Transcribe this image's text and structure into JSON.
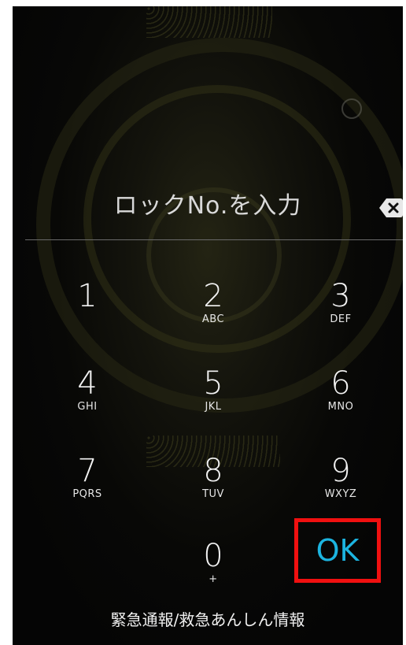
{
  "lock_screen": {
    "prompt": "ロックNo.を入力",
    "backspace_icon": "backspace-icon",
    "accent_color": "#1cb4e0",
    "highlight_color": "#f01010"
  },
  "keypad": {
    "keys": [
      {
        "digit": "1",
        "letters": ""
      },
      {
        "digit": "2",
        "letters": "ABC"
      },
      {
        "digit": "3",
        "letters": "DEF"
      },
      {
        "digit": "4",
        "letters": "GHI"
      },
      {
        "digit": "5",
        "letters": "JKL"
      },
      {
        "digit": "6",
        "letters": "MNO"
      },
      {
        "digit": "7",
        "letters": "PQRS"
      },
      {
        "digit": "8",
        "letters": "TUV"
      },
      {
        "digit": "9",
        "letters": "WXYZ"
      },
      {
        "digit": "0",
        "letters": "+"
      }
    ],
    "ok_label": "OK"
  },
  "footer": {
    "emergency_label": "緊急通報/救急あんしん情報"
  }
}
